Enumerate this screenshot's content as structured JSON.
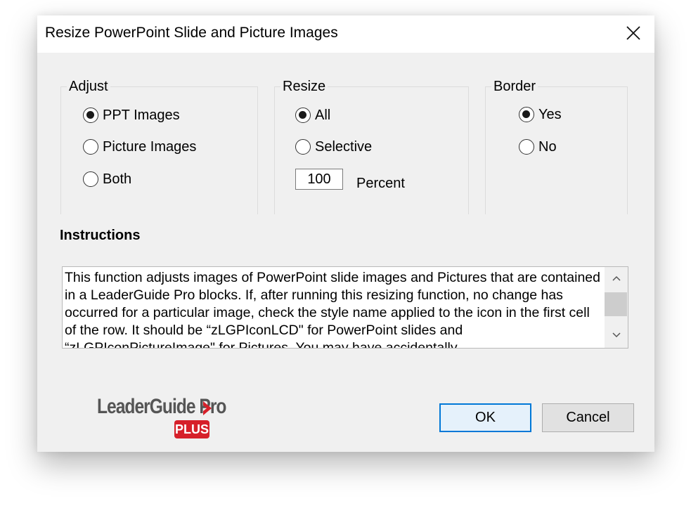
{
  "window": {
    "title": "Resize PowerPoint Slide and Picture Images"
  },
  "adjust": {
    "legend": "Adjust",
    "options": [
      {
        "label": "PPT Images",
        "selected": true
      },
      {
        "label": "Picture Images",
        "selected": false
      },
      {
        "label": "Both",
        "selected": false
      }
    ]
  },
  "resize": {
    "legend": "Resize",
    "options": [
      {
        "label": "All",
        "selected": true
      },
      {
        "label": "Selective",
        "selected": false
      }
    ],
    "percent_value": "100",
    "percent_label": "Percent"
  },
  "border": {
    "legend": "Border",
    "options": [
      {
        "label": "Yes",
        "selected": true
      },
      {
        "label": "No",
        "selected": false
      }
    ]
  },
  "instructions": {
    "heading": "Instructions",
    "text": "This function adjusts images of PowerPoint slide images and Pictures that are contained in a LeaderGuide Pro blocks. If, after running this resizing function, no change has occurred for a particular image, check the style name applied to the icon in the first cell of the row. It should be “zLGPIconLCD\" for PowerPoint slides and “zLGPIconPictureImage\" for Pictures. You may have accidentally"
  },
  "logo": {
    "main": "LeaderGuide Pro",
    "badge": "PLUS"
  },
  "buttons": {
    "ok": "OK",
    "cancel": "Cancel"
  },
  "colors": {
    "dialog_bg": "#f0f0f0",
    "accent": "#0078d7",
    "logo_red": "#d6202a"
  }
}
